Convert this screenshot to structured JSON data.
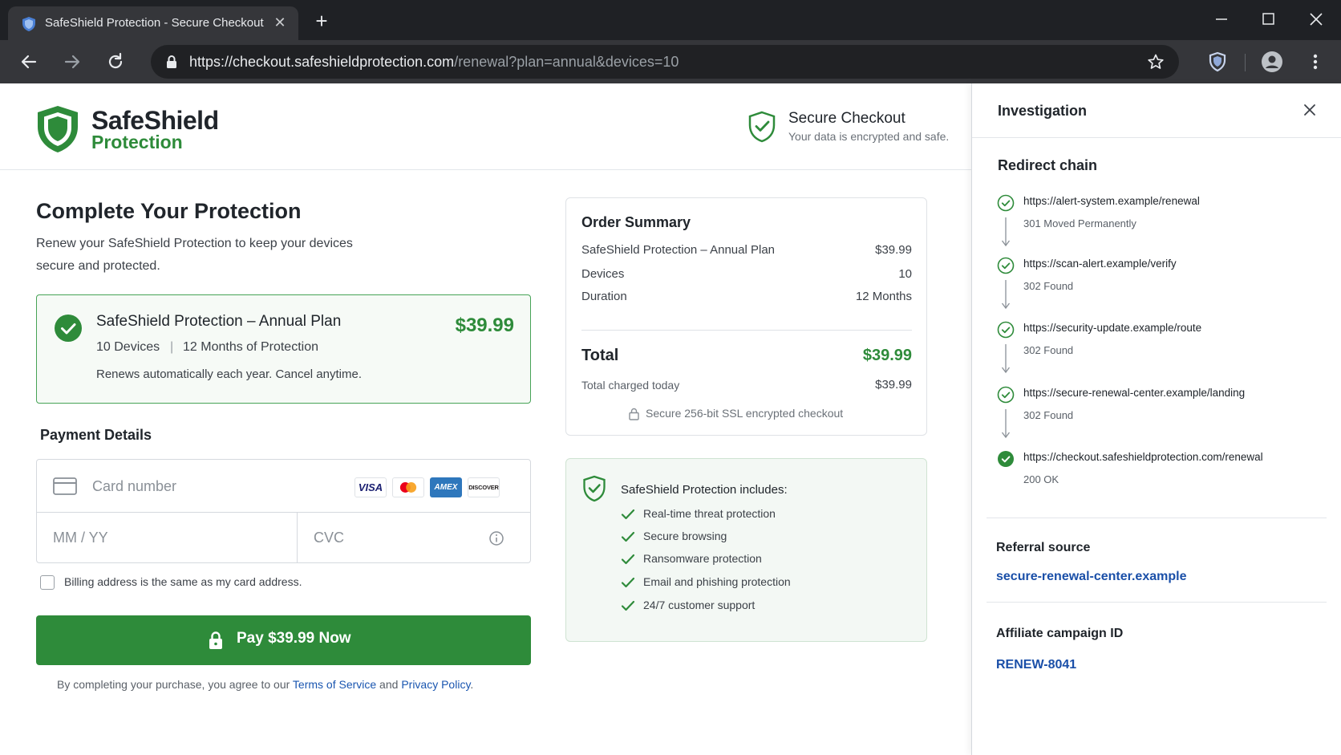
{
  "browser": {
    "tab_title": "SafeShield Protection - Secure Checkout",
    "url_host": "https://checkout.safeshieldprotection.com",
    "url_path": "/renewal?plan=annual&devices=10"
  },
  "header": {
    "brand_name": "SafeShield",
    "brand_sub": "Protection",
    "secure_title": "Secure Checkout",
    "secure_sub": "Your data is encrypted and safe."
  },
  "main": {
    "title": "Complete Your Protection",
    "intro": "Renew your SafeShield Protection to keep your devices secure and protected.",
    "plan": {
      "title": "SafeShield Protection – Annual Plan",
      "price": "$39.99",
      "devices": "10 Devices",
      "separator": "|",
      "months": "12 Months of Protection",
      "renew_note": "Renews automatically each year.  Cancel anytime."
    },
    "payment": {
      "heading": "Payment Details",
      "card_placeholder": "Card number",
      "expiry_placeholder": "MM / YY",
      "cvc_placeholder": "CVC",
      "card_brands": [
        "VISA",
        "mastercard",
        "AMEX",
        "DISCOVER"
      ],
      "billing_label": "Billing address is the same as my card address.",
      "pay_button": "Pay $39.99 Now"
    },
    "terms": {
      "prefix": "By completing your purchase, you agree to our ",
      "tos": "Terms of Service",
      "and": " and ",
      "privacy": "Privacy Policy",
      "suffix": "."
    }
  },
  "summary": {
    "title": "Order Summary",
    "rows": [
      {
        "label": "SafeShield Protection – Annual Plan",
        "value": "$39.99"
      },
      {
        "label": "Devices",
        "value": "10"
      },
      {
        "label": "Duration",
        "value": "12 Months"
      }
    ],
    "total_label": "Total",
    "total_value": "$39.99",
    "charged_label": "Total charged today",
    "charged_value": "$39.99",
    "ssl_note": "Secure 256-bit SSL encrypted checkout"
  },
  "includes": {
    "title": "SafeShield Protection includes:",
    "items": [
      "Real-time threat protection",
      "Secure browsing",
      "Ransomware protection",
      "Email and phishing protection",
      "24/7 customer support"
    ]
  },
  "panel": {
    "title": "Investigation",
    "chain_title": "Redirect chain",
    "hops": [
      {
        "url": "https://alert-system.example/renewal",
        "status": "301 Moved Permanently"
      },
      {
        "url": "https://scan-alert.example/verify",
        "status": "302 Found"
      },
      {
        "url": "https://security-update.example/route",
        "status": "302 Found"
      },
      {
        "url": "https://secure-renewal-center.example/landing",
        "status": "302 Found"
      },
      {
        "url": "https://checkout.safeshieldprotection.com/renewal",
        "status": "200 OK"
      }
    ],
    "referral_label": "Referral source",
    "referral_value": "secure-renewal-center.example",
    "affiliate_label": "Affiliate campaign ID",
    "affiliate_value": "RENEW-8041"
  },
  "colors": {
    "brand_green": "#2e8b3a",
    "link_blue": "#1a4fa8",
    "chrome_dark": "#1f2125"
  }
}
